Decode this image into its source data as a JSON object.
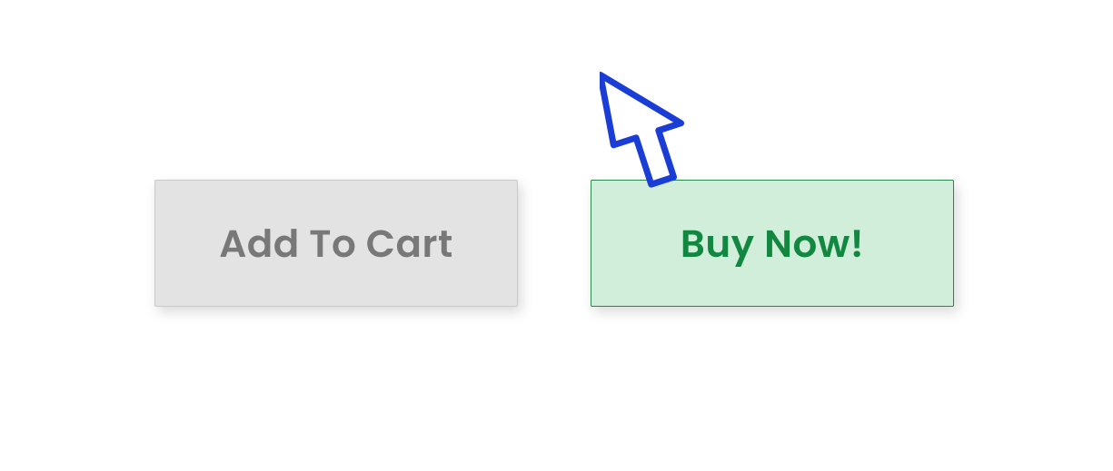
{
  "buttons": {
    "add_to_cart": {
      "label": "Add To Cart"
    },
    "buy_now": {
      "label": "Buy Now!"
    }
  },
  "colors": {
    "secondary_bg": "#e3e3e3",
    "secondary_border": "#c9c9c9",
    "secondary_text": "#787878",
    "primary_bg": "#d0eed9",
    "primary_border": "#28894a",
    "primary_text": "#118740",
    "arrow_stroke": "#1a3dd6"
  },
  "pointer": {
    "icon_name": "cursor-arrow-icon",
    "target": "buy-now-button"
  }
}
